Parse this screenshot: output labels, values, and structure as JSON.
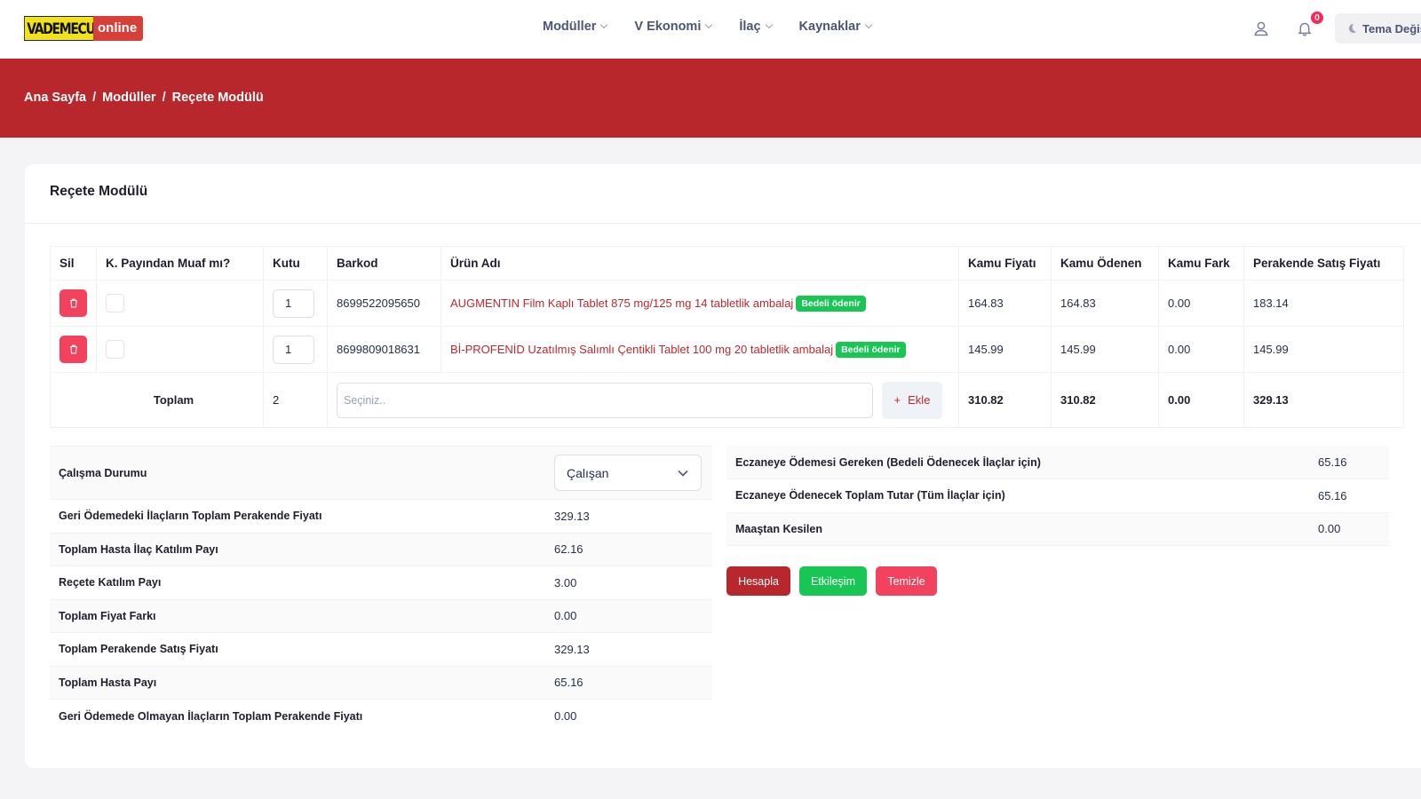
{
  "header": {
    "logo_left": "VADEMECUM",
    "logo_right": "online",
    "nav": [
      "Modüller",
      "V Ekonomi",
      "İlaç",
      "Kaynaklar"
    ],
    "notification_count": "0",
    "theme_label": "Tema Değiş"
  },
  "breadcrumb": [
    "Ana Sayfa",
    "Modüller",
    "Reçete Modülü"
  ],
  "card_title": "Reçete Modülü",
  "table": {
    "headers": [
      "Sil",
      "K. Payından Muaf mı?",
      "Kutu",
      "Barkod",
      "Ürün Adı",
      "Kamu Fiyatı",
      "Kamu Ödenen",
      "Kamu Fark",
      "Perakende Satış Fiyatı"
    ],
    "rows": [
      {
        "qty": "1",
        "barcode": "8699522095650",
        "product": "AUGMENTIN Film Kaplı Tablet 875 mg/125 mg 14 tabletlik ambalaj",
        "badge": "Bedeli ödenir",
        "kamu_fiyati": "164.83",
        "kamu_odenen": "164.83",
        "kamu_fark": "0.00",
        "perakende": "183.14"
      },
      {
        "qty": "1",
        "barcode": "8699809018631",
        "product": "Bİ-PROFENİD Uzatılmış Salımlı Çentikli Tablet 100 mg 20 tabletlik ambalaj",
        "badge": "Bedeli ödenir",
        "kamu_fiyati": "145.99",
        "kamu_odenen": "145.99",
        "kamu_fark": "0.00",
        "perakende": "145.99"
      }
    ],
    "total": {
      "label": "Toplam",
      "qty": "2",
      "search_placeholder": "Seçiniz..",
      "add_label": "Ekle",
      "kamu_fiyati": "310.82",
      "kamu_odenen": "310.82",
      "kamu_fark": "0.00",
      "perakende": "329.13"
    }
  },
  "summary": {
    "work_status_label": "Çalışma Durumu",
    "work_status_value": "Çalışan",
    "rows": [
      {
        "label": "Geri Ödemedeki İlaçların Toplam Perakende Fiyatı",
        "value": "329.13"
      },
      {
        "label": "Toplam Hasta İlaç Katılım Payı",
        "value": "62.16"
      },
      {
        "label": "Reçete Katılım Payı",
        "value": "3.00"
      },
      {
        "label": "Toplam Fiyat Farkı",
        "value": "0.00"
      },
      {
        "label": "Toplam Perakende Satış Fiyatı",
        "value": "329.13"
      },
      {
        "label": "Toplam Hasta Payı",
        "value": "65.16"
      },
      {
        "label": "Geri Ödemede Olmayan İlaçların Toplam Perakende Fiyatı",
        "value": "0.00"
      }
    ]
  },
  "payments": [
    {
      "label": "Eczaneye Ödemesi Gereken (Bedeli Ödenecek İlaçlar için)",
      "value": "65.16"
    },
    {
      "label": "Eczaneye Ödenecek Toplam Tutar (Tüm İlaçlar için)",
      "value": "65.16"
    },
    {
      "label": "Maaştan Kesilen",
      "value": "0.00"
    }
  ],
  "actions": {
    "calculate": "Hesapla",
    "interaction": "Etkileşim",
    "clear": "Temizle"
  },
  "colors": {
    "brand_red": "#b7272b",
    "success": "#17c653",
    "danger": "#f2425e"
  }
}
